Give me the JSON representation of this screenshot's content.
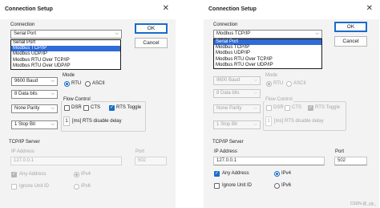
{
  "left": {
    "title": "Connection Setup",
    "connection_label": "Connection",
    "connection_value": "Serial Port",
    "dropdown_options": [
      "Serial Port",
      "Modbus TCP/IP",
      "Modbus UDP/IP",
      "Modbus RTU Over TCP/IP",
      "Modbus RTU Over UDP/IP"
    ],
    "dropdown_selected": "Modbus TCP/IP",
    "ok_label": "OK",
    "cancel_label": "Cancel",
    "baud": "9600 Baud",
    "mode_label": "Mode",
    "rtu_label": "RTU",
    "ascii_label": "ASCII",
    "data_bits": "8 Data bits",
    "flow_label": "Flow Control",
    "dsr_label": "DSR",
    "cts_label": "CTS",
    "rts_toggle_label": "RTS Toggle",
    "parity": "None Parity",
    "rts_delay_value": "1",
    "rts_delay_label": "[ms] RTS disable delay",
    "stop_bits": "1 Stop Bit",
    "tcpip_label": "TCP/IP Server",
    "ip_label": "IP Address",
    "ip_value": "127.0.0.1",
    "port_label": "Port",
    "port_value": "502",
    "any_address_label": "Any Address",
    "ipv4_label": "IPv4",
    "ignore_unit_label": "Ignore Unit ID",
    "ipv6_label": "IPv6"
  },
  "right": {
    "title": "Connection Setup",
    "connection_label": "Connection",
    "connection_value": "Modbus TCP/IP",
    "dropdown_options": [
      "Serial Port",
      "Modbus TCP/IP",
      "Modbus UDP/IP",
      "Modbus RTU Over TCP/IP",
      "Modbus RTU Over UDP/IP"
    ],
    "dropdown_selected": "Serial Port",
    "ok_label": "OK",
    "cancel_label": "Cancel",
    "baud": "9600 Baud",
    "mode_label": "Mode",
    "rtu_label": "RTU",
    "ascii_label": "ASCII",
    "data_bits": "8 Data bits",
    "flow_label": "Flow Control",
    "dsr_label": "DSR",
    "cts_label": "CTS",
    "rts_toggle_label": "RTS Toggle",
    "parity": "None Parity",
    "rts_delay_value": "1",
    "rts_delay_label": "[ms] RTS disable delay",
    "stop_bits": "1 Stop Bit",
    "tcpip_label": "TCP/IP Server",
    "ip_label": "IP Address",
    "ip_value": "127.0.0.1",
    "port_label": "Port",
    "port_value": "502",
    "any_address_label": "Any Address",
    "ipv4_label": "IPv4",
    "ignore_unit_label": "Ignore Unit ID",
    "ipv6_label": "IPv6"
  },
  "watermark": "CSDN @_yjy_",
  "colors": {
    "accent": "#1a6cc9",
    "selection": "#2f6bd8",
    "disabled_text": "#a6a6a6"
  }
}
